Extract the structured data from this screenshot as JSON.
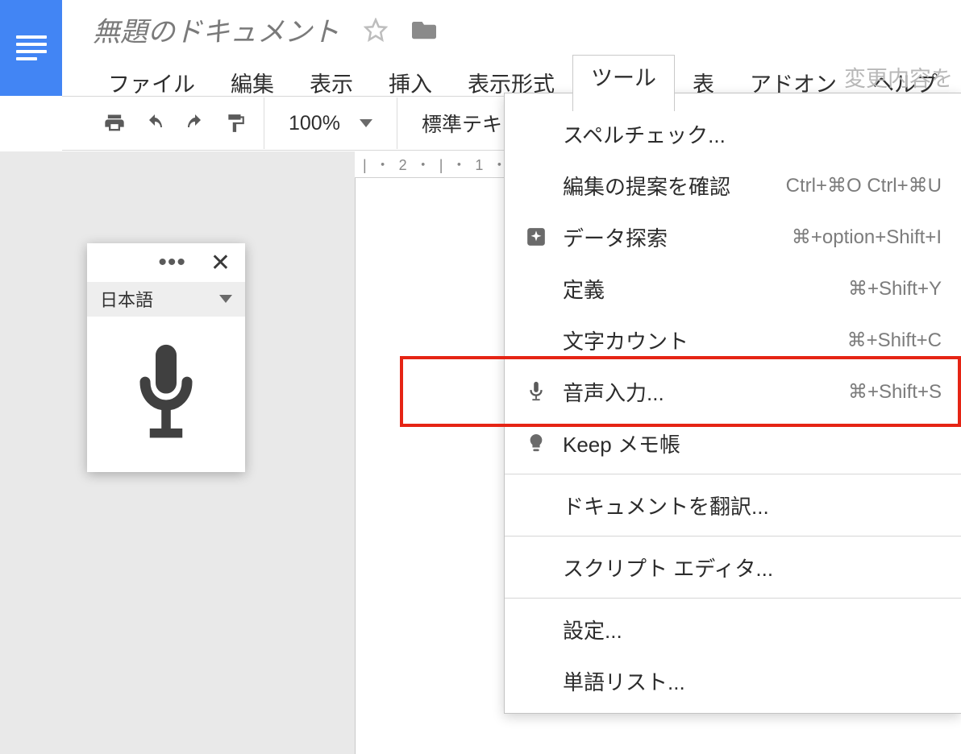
{
  "doc": {
    "title": "無題のドキュメント"
  },
  "menubar": {
    "items": [
      "ファイル",
      "編集",
      "表示",
      "挿入",
      "表示形式",
      "ツール",
      "表",
      "アドオン",
      "ヘルプ"
    ],
    "active_index": 5,
    "changes_hint": "変更内容を"
  },
  "toolbar": {
    "zoom": "100%",
    "style": "標準テキ"
  },
  "ruler": {
    "text": "| ・ 2 ・ | ・ 1 ・ | ・"
  },
  "voice_panel": {
    "language": "日本語"
  },
  "tools_menu": {
    "items": [
      {
        "label": "スペルチェック...",
        "shortcut": "",
        "icon": ""
      },
      {
        "label": "編集の提案を確認",
        "shortcut": "Ctrl+⌘O Ctrl+⌘U",
        "icon": ""
      },
      {
        "label": "データ探索",
        "shortcut": "⌘+option+Shift+I",
        "icon": "explore"
      },
      {
        "label": "定義",
        "shortcut": "⌘+Shift+Y",
        "icon": ""
      },
      {
        "label": "文字カウント",
        "shortcut": "⌘+Shift+C",
        "icon": ""
      },
      {
        "label": "音声入力...",
        "shortcut": "⌘+Shift+S",
        "icon": "mic"
      },
      {
        "label": "Keep メモ帳",
        "shortcut": "",
        "icon": "bulb"
      },
      {
        "label": "ドキュメントを翻訳...",
        "shortcut": "",
        "icon": ""
      },
      {
        "label": "スクリプト エディタ...",
        "shortcut": "",
        "icon": ""
      },
      {
        "label": "設定...",
        "shortcut": "",
        "icon": ""
      },
      {
        "label": "単語リスト...",
        "shortcut": "",
        "icon": ""
      }
    ],
    "highlight_index": 5,
    "separators_after": [
      6,
      7,
      8
    ]
  }
}
